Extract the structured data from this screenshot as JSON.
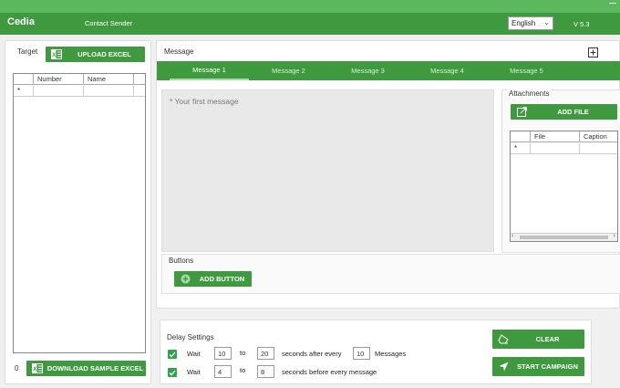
{
  "header": {
    "app_name": "Cedia",
    "subtitle": "Contact Sender",
    "language": "English",
    "version": "V 5.3"
  },
  "left": {
    "target_label": "Target",
    "upload_excel": "UPLOAD EXCEL",
    "columns": [
      "Number",
      "Name"
    ],
    "new_row_marker": "*",
    "count": "0",
    "download_sample": "DOWNLOAD SAMPLE EXCEL"
  },
  "message": {
    "section_label": "Message",
    "add_icon": "plus-square-icon",
    "tabs": [
      "Message 1",
      "Message 2",
      "Message 3",
      "Message 4",
      "Message 5"
    ],
    "active_tab": 0,
    "placeholder": "* Your first message",
    "attachments_label": "Attachments",
    "add_file": "ADD FILE",
    "file_columns": [
      "File",
      "Caption"
    ],
    "new_row_marker": "*",
    "buttons_label": "Buttons",
    "add_button": "ADD BUTTON"
  },
  "delay": {
    "title": "Delay Settings",
    "row1": {
      "checked": true,
      "wait": "Wait",
      "from": "10",
      "to_label": "to",
      "to": "20",
      "after": "seconds after every",
      "every": "10",
      "messages": "Messages"
    },
    "row2": {
      "checked": true,
      "wait": "Wait",
      "from": "4",
      "to_label": "to",
      "to": "8",
      "before": "seconds before every message"
    }
  },
  "actions": {
    "clear": "CLEAR",
    "start": "START CAMPAIGN"
  },
  "colors": {
    "primary": "#3f9a3f",
    "topstrip": "#5cb85c",
    "checkbox": "#2fa44f"
  }
}
